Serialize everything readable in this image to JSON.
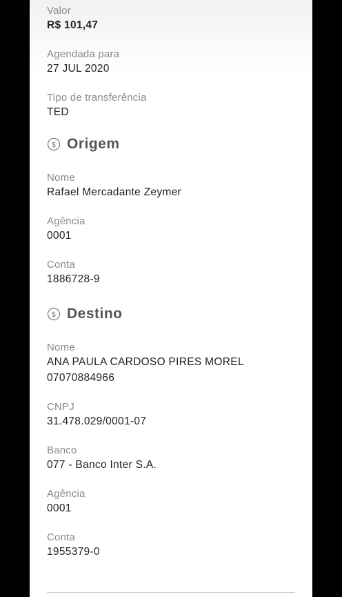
{
  "summary": {
    "valor_label": "Valor",
    "valor_value": "R$ 101,47",
    "agendada_label": "Agendada para",
    "agendada_value": "27 JUL 2020",
    "tipo_label": "Tipo de transferência",
    "tipo_value": "TED"
  },
  "origem": {
    "title": "Origem",
    "icon": "dollar-coin-icon",
    "nome_label": "Nome",
    "nome_value": "Rafael Mercadante Zeymer",
    "agencia_label": "Agência",
    "agencia_value": "0001",
    "conta_label": "Conta",
    "conta_value": "1886728-9"
  },
  "destino": {
    "title": "Destino",
    "icon": "dollar-coin-icon",
    "nome_label": "Nome",
    "nome_value_line1": "ANA PAULA CARDOSO PIRES MOREL",
    "nome_value_line2": "07070884966",
    "cnpj_label": "CNPJ",
    "cnpj_value": "31.478.029/0001-07",
    "banco_label": "Banco",
    "banco_value": "077 - Banco Inter S.A.",
    "agencia_label": "Agência",
    "agencia_value": "0001",
    "conta_label": "Conta",
    "conta_value": "1955379-0"
  },
  "colors": {
    "label": "#8a8a8a",
    "value": "#222222",
    "section_title": "#555555",
    "background": "#ffffff",
    "frame": "#000000"
  }
}
